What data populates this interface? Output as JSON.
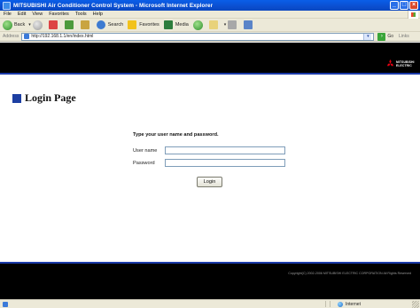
{
  "window": {
    "title": "MITSUBISHI Air Conditioner Control System - Microsoft Internet Explorer",
    "minimize_label": "_",
    "maximize_label": "□",
    "close_label": "×"
  },
  "menu": [
    "File",
    "Edit",
    "View",
    "Favorites",
    "Tools",
    "Help"
  ],
  "toolbar": {
    "back_label": "Back",
    "search_label": "Search",
    "favorites_label": "Favorites",
    "media_label": "Media"
  },
  "addressbar": {
    "label": "Address",
    "url": "http://192.168.1.1/en/index.html",
    "go_label": "Go",
    "links_label": "Links"
  },
  "brand": {
    "line1": "MITSUBISHI",
    "line2": "ELECTRIC"
  },
  "login": {
    "heading": "Login Page",
    "prompt": "Type your user name and password.",
    "username_label": "User name",
    "password_label": "Password",
    "username_value": "",
    "password_value": "",
    "button_label": "Login"
  },
  "footer": {
    "copyright": "Copyright(C) 2002-2006 MITSUBISHI ELECTRIC CORPORATION All Rights Reserved"
  },
  "statusbar": {
    "zone": "Internet"
  },
  "colors": {
    "header_black": "#000000",
    "accent_blue": "#1d3fa2",
    "brand_red": "#e60012"
  }
}
